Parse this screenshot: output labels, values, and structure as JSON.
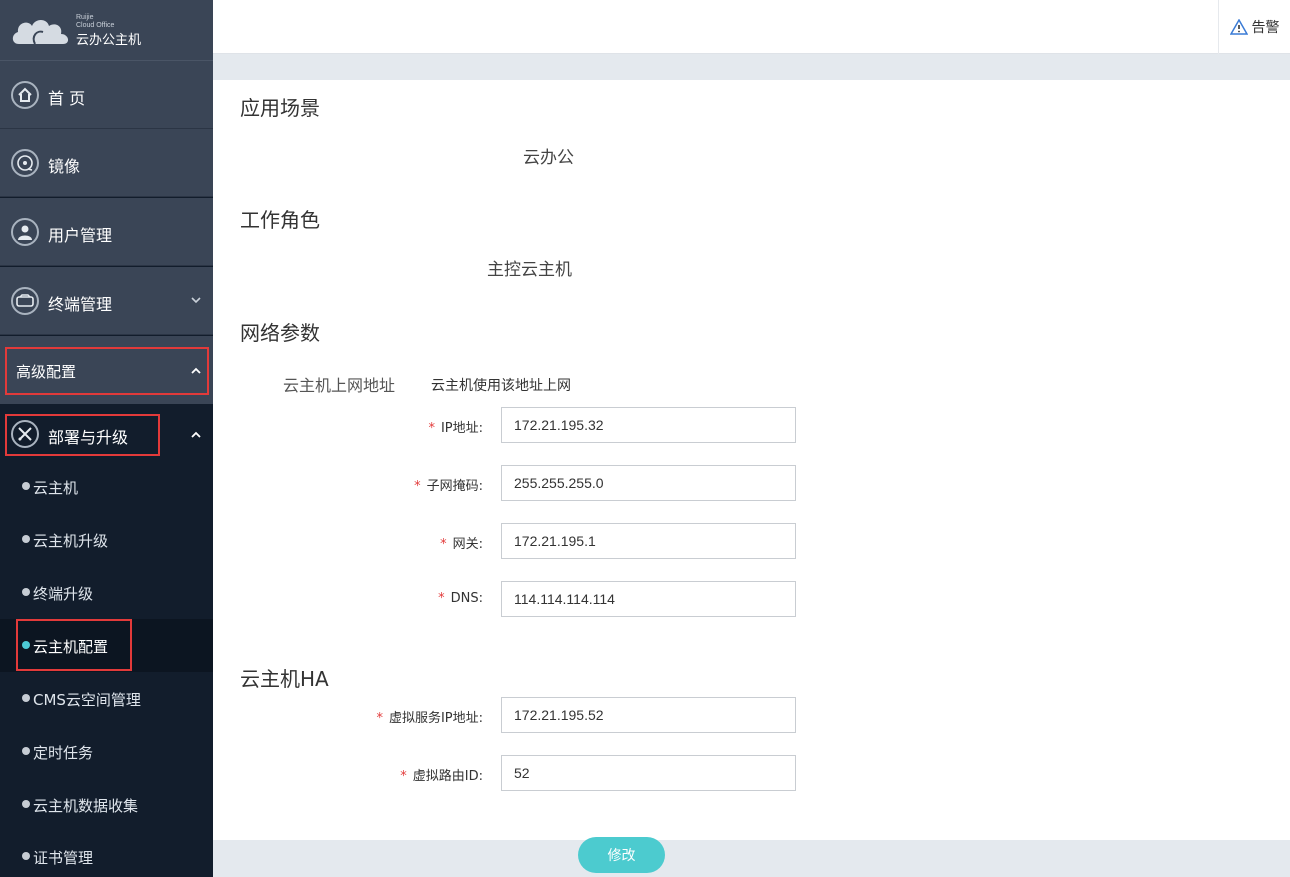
{
  "logo": {
    "brand_small_1": "Ruijie",
    "brand_small_2": "Cloud Office",
    "brand_name": "云办公主机"
  },
  "header": {
    "alarm_label": "告警",
    "alarm_icon": "warning-triangle-icon"
  },
  "sidebar": {
    "items": [
      {
        "label": "首 页",
        "icon": "home-icon"
      },
      {
        "label": "镜像",
        "icon": "disc-icon"
      },
      {
        "label": "用户管理",
        "icon": "user-icon"
      },
      {
        "label": "终端管理",
        "icon": "terminal-icon"
      }
    ],
    "advanced": "高级配置",
    "deploy": {
      "label": "部署与升级",
      "icon": "tools-icon"
    },
    "sub_items": [
      "云主机",
      "云主机升级",
      "终端升级",
      "云主机配置",
      "CMS云空间管理",
      "定时任务",
      "云主机数据收集",
      "证书管理"
    ],
    "active_sub": "云主机配置"
  },
  "main": {
    "scenario_title": "应用场景",
    "scenario_value": "云办公",
    "role_title": "工作角色",
    "role_value": "主控云主机",
    "network_title": "网络参数",
    "network_sub_title": "云主机上网地址",
    "network_sub_hint": "云主机使用该地址上网",
    "fields": {
      "ip_label": "IP地址:",
      "ip_value": "172.21.195.32",
      "mask_label": "子网掩码:",
      "mask_value": "255.255.255.0",
      "gateway_label": "网关:",
      "gateway_value": "172.21.195.1",
      "dns_label": "DNS:",
      "dns_value": "114.114.114.114"
    },
    "ha_title": "云主机HA",
    "ha_fields": {
      "vip_label": "虚拟服务IP地址:",
      "vip_value": "172.21.195.52",
      "vrid_label": "虚拟路由ID:",
      "vrid_value": "52"
    },
    "required_mark": "*"
  },
  "footer": {
    "modify_label": "修改"
  },
  "colors": {
    "accent": "#4ccbcf",
    "highlight": "#e23a3a",
    "sidebar_bg": "#121d2c",
    "sidebar_panel": "#3a4556"
  }
}
